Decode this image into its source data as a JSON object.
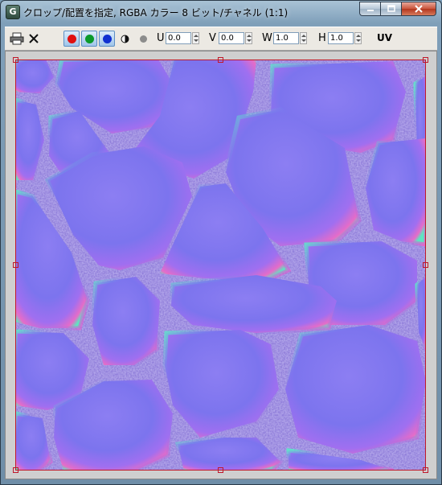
{
  "window": {
    "title": "クロップ/配置を指定, RGBA カラー 8 ビット/チャネル (1:1)",
    "icon_letter": "G"
  },
  "toolbar": {
    "channels": [
      {
        "name": "red",
        "color": "#e01010"
      },
      {
        "name": "green",
        "color": "#0a9a2a"
      },
      {
        "name": "blue",
        "color": "#1030d0"
      }
    ],
    "u_label": "U",
    "u_value": "0.0",
    "v_label": "V",
    "v_value": "0.0",
    "w_label": "W",
    "w_value": "1.0",
    "h_label": "H",
    "h_value": "1.0",
    "uv_label": "UV"
  },
  "icons": [
    "print-icon",
    "close-x-icon",
    "alpha-icon",
    "mono-icon"
  ],
  "colors": {
    "crop_border": "#c0182a",
    "stone_base": "#8a7be8"
  }
}
